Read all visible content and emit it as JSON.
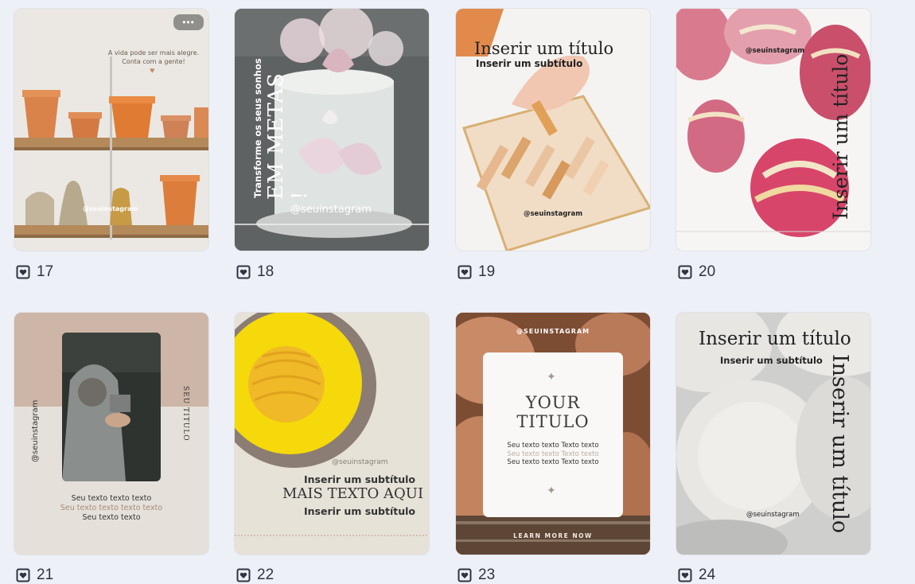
{
  "pages": [
    {
      "num": "17",
      "text1": "A vida pode ser mais alegre.",
      "text2": "Conta com a gente!",
      "handle": "@seuinstagram",
      "menu": "•••"
    },
    {
      "num": "18",
      "line1": "Transforme os seus sonhos",
      "line2": "EM METAS !",
      "handle": "@seuinstagram"
    },
    {
      "num": "19",
      "title": "Inserir um título",
      "subtitle": "Inserir um subtítulo",
      "handle": "@seuinstagram"
    },
    {
      "num": "20",
      "handle": "@seuinstagram",
      "title": "Inserir um título"
    },
    {
      "num": "21",
      "handle": "@seuinstagram",
      "side": "SEU TITULO",
      "t1": "Seu texto texto texto",
      "t2": "Seu texto texto texto texto",
      "t3": "Seu texto texto"
    },
    {
      "num": "22",
      "handle": "@seuinstagram",
      "sub1": "Inserir um subtítulo",
      "main": "MAIS TEXTO AQUI",
      "sub2": "Inserir um subtítulo"
    },
    {
      "num": "23",
      "handle": "@SEUINSTAGRAM",
      "title1": "YOUR",
      "title2": "TITULO",
      "l1": "Seu texto texto Texto texto",
      "l2": "Seu texto texto Texto texto",
      "l3": "Seu texto texto Texto texto",
      "cta": "LEARN MORE NOW"
    },
    {
      "num": "24",
      "title": "Inserir um título",
      "subtitle": "Inserir um subtítulo",
      "vertical": "Inserir um título",
      "handle": "@seuinstagram"
    }
  ],
  "colors": {
    "background": "#eef0f7",
    "text": "#2e3440"
  }
}
